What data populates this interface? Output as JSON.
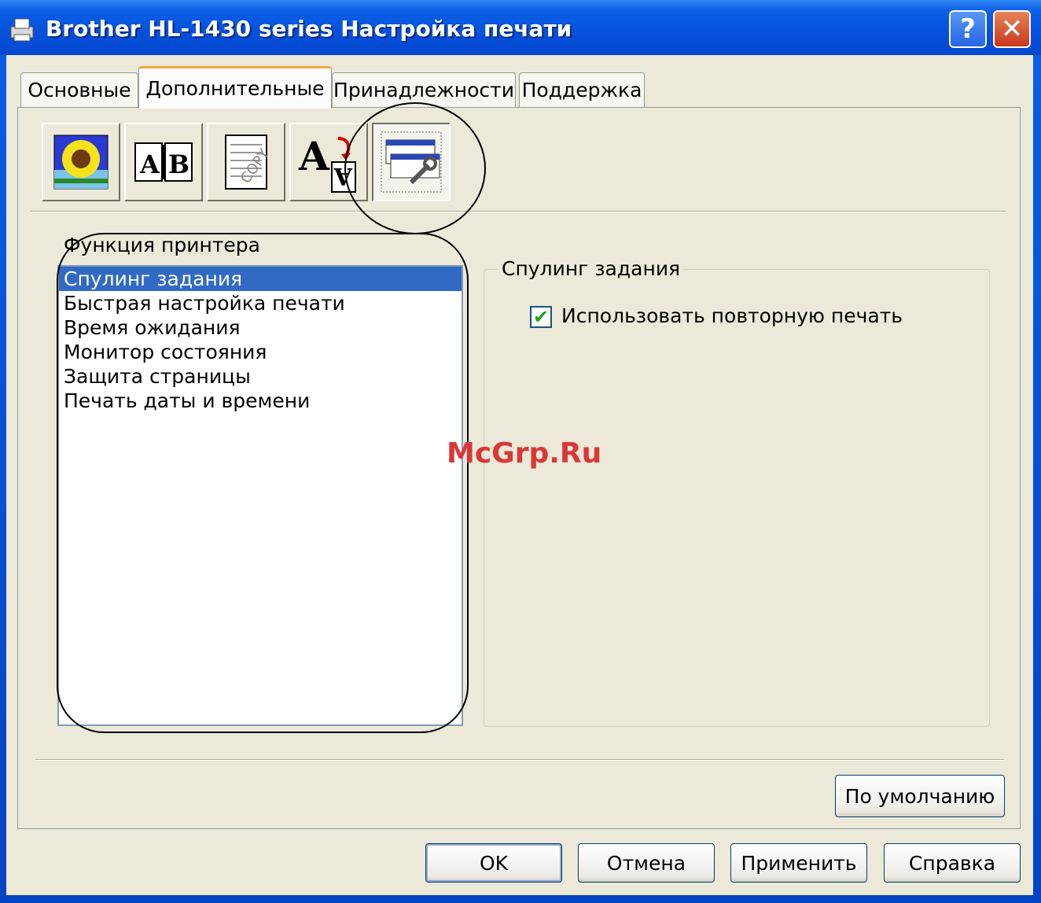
{
  "window": {
    "title": "Brother HL-1430 series Настройка печати",
    "help_glyph": "?",
    "close_glyph": "✕"
  },
  "tabs": [
    {
      "label": "Основные",
      "active": false
    },
    {
      "label": "Дополнительные",
      "active": true
    },
    {
      "label": "Принадлежности",
      "active": false
    },
    {
      "label": "Поддержка",
      "active": false
    }
  ],
  "toolbar_icons": [
    "quality-sunflower-icon",
    "duplex-ab-icon",
    "copy-watermark-icon",
    "scaling-font-icon",
    "device-options-icon"
  ],
  "toolbar_text": {
    "ab": "A",
    "ab2": "B",
    "copy": "COPY",
    "font_big": "A",
    "font_small": "A"
  },
  "left": {
    "section_label": "Функция принтера",
    "items": [
      {
        "label": "Спулинг задания",
        "selected": true
      },
      {
        "label": "Быстрая настройка печати",
        "selected": false
      },
      {
        "label": "Время ожидания",
        "selected": false
      },
      {
        "label": "Монитор состояния",
        "selected": false
      },
      {
        "label": "Защита страницы",
        "selected": false
      },
      {
        "label": "Печать даты и времени",
        "selected": false
      }
    ]
  },
  "group": {
    "title": "Спулинг задания",
    "checkbox_label": "Использовать повторную печать",
    "checkbox_checked": true,
    "check_glyph": "✔"
  },
  "buttons": {
    "default": "По умолчанию",
    "ok": "OK",
    "cancel": "Отмена",
    "apply": "Применить",
    "help": "Справка"
  },
  "watermark": "McGrp.Ru",
  "colors": {
    "titlebar": "#0550dc",
    "selection": "#316ac5",
    "face": "#ece9d8",
    "watermark": "#d93838"
  }
}
